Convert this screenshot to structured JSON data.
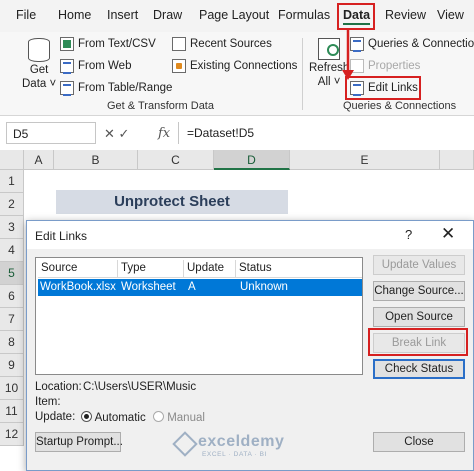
{
  "ribbon_tabs": [
    "File",
    "Home",
    "Insert",
    "Draw",
    "Page Layout",
    "Formulas",
    "Data",
    "Review",
    "View"
  ],
  "active_tab": "Data",
  "ribbon": {
    "get_data_line1": "Get",
    "get_data_line2": "Data ˅",
    "from_text_csv": "From Text/CSV",
    "from_web": "From Web",
    "from_table_range": "From Table/Range",
    "recent_sources": "Recent Sources",
    "existing_connections": "Existing Connections",
    "group1_label": "Get & Transform Data",
    "refresh_line1": "Refresh",
    "refresh_line2": "All ˅",
    "queries_connections": "Queries & Connections",
    "properties": "Properties",
    "edit_links": "Edit Links",
    "group2_label": "Queries & Connections"
  },
  "formula_bar": {
    "name_box": "D5",
    "fx_icons": "✕ ✓",
    "fx_label": "fx",
    "formula": "=Dataset!D5"
  },
  "columns": [
    "A",
    "B",
    "C",
    "D",
    "E"
  ],
  "selected_column": "D",
  "rows": [
    "1",
    "2",
    "3",
    "4",
    "5",
    "6",
    "7",
    "8",
    "9",
    "10",
    "11",
    "12"
  ],
  "selected_row": "5",
  "sheet_title": "Unprotect Sheet",
  "dialog": {
    "title": "Edit Links",
    "help": "?",
    "close": "✕",
    "headers": [
      "Source",
      "Type",
      "Update",
      "Status"
    ],
    "row": {
      "source": "WorkBook.xlsx",
      "type": "Worksheet",
      "update": "A",
      "status": "Unknown"
    },
    "buttons": {
      "update_values": "Update Values",
      "change_source": "Change Source...",
      "open_source": "Open Source",
      "break_link": "Break Link",
      "check_status": "Check Status",
      "startup_prompt": "Startup Prompt...",
      "close": "Close"
    },
    "location_label": "Location:",
    "location_value": "C:\\Users\\USER\\Music",
    "item_label": "Item:",
    "update_label": "Update:",
    "automatic_label": "Automatic",
    "manual_label": "Manual",
    "update_mode": "Automatic"
  },
  "watermark": {
    "brand": "exceldemy",
    "tagline": "EXCEL · DATA · BI"
  },
  "colors": {
    "accent_green": "#217346",
    "highlight_red": "#d62020",
    "selection_blue": "#0078d7"
  }
}
